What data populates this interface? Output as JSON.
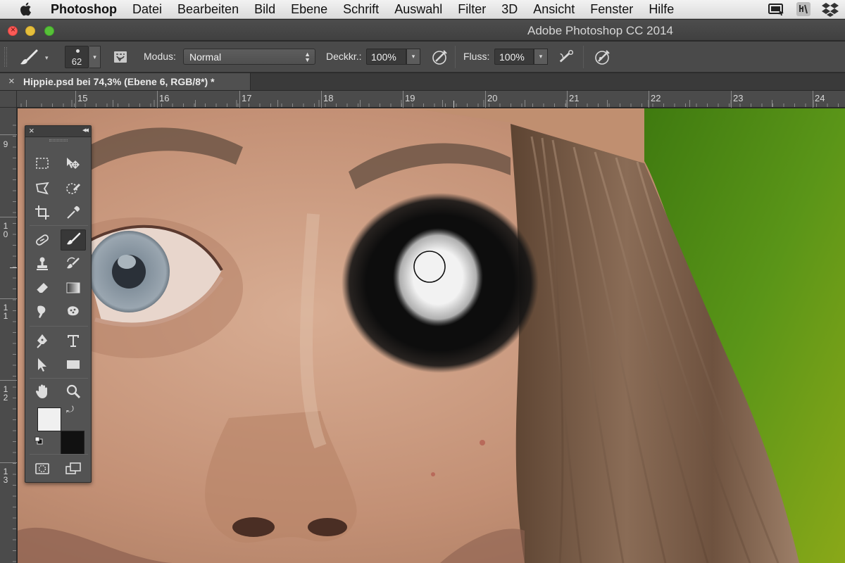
{
  "menubar": {
    "app_name": "Photoshop",
    "items": [
      "Datei",
      "Bearbeiten",
      "Bild",
      "Ebene",
      "Schrift",
      "Auswahl",
      "Filter",
      "3D",
      "Ansicht",
      "Fenster",
      "Hilfe"
    ],
    "status_icons": [
      "display-icon",
      "adobe-activity-icon",
      "dropbox-icon"
    ]
  },
  "window": {
    "title": "Adobe Photoshop CC 2014"
  },
  "options_bar": {
    "brush_size": "62",
    "mode_label": "Modus:",
    "mode_value": "Normal",
    "opacity_label": "Deckkr.:",
    "opacity_value": "100%",
    "flow_label": "Fluss:",
    "flow_value": "100%"
  },
  "document": {
    "tab_title": "Hippie.psd bei 74,3% (Ebene 6, RGB/8*) *",
    "close_glyph": "×"
  },
  "rulers": {
    "top_labels": [
      "15",
      "16",
      "17",
      "18",
      "19",
      "20",
      "21",
      "22",
      "23",
      "24"
    ],
    "left_labels": [
      "9",
      "10",
      "11",
      "12",
      "13"
    ]
  },
  "tools_panel": {
    "close_glyph": "×",
    "collapse_glyph": "◂◂",
    "foreground_color": "#f0f0f0",
    "background_color": "#111111",
    "active_tool": "brush-tool"
  },
  "colors": {
    "canvas_skin": "#c49478",
    "green_background": "#4e8a1a",
    "paint_black": "#0d0d0d",
    "paint_white": "#f2f2f2"
  }
}
